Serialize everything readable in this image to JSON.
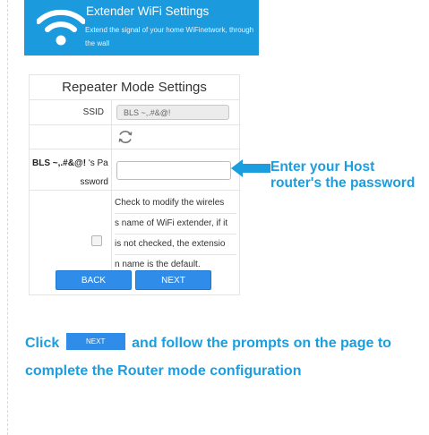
{
  "banner": {
    "title": "Extender WiFi Settings",
    "subtitle": "Extend the signal of your home WiFinetwork, through the wall"
  },
  "panel": {
    "title": "Repeater Mode Settings",
    "ssid_label": "SSID",
    "ssid_value": "BLS ~,.#&@!",
    "password_label_bold": "BLS ~,.#&@!",
    "password_label_suffix": " 's Pa",
    "password_label_line2": "ssword",
    "password_value": "",
    "check_text_lines": [
      "Check to modify the wireles",
      "s name of WiFi extender, if it",
      "is not checked, the extensio",
      "n name is the default."
    ],
    "checkbox_checked": false,
    "back_label": "BACK",
    "next_label": "NEXT"
  },
  "callout": {
    "text": "Enter your Host router's the password"
  },
  "instruction": {
    "click": "Click",
    "button_label": "NEXT",
    "rest": "and follow the prompts on the page to complete the Router mode configuration"
  },
  "icons": {
    "wifi": "wifi-icon",
    "refresh": "refresh-icon",
    "arrow": "arrow-left-icon"
  },
  "colors": {
    "accent": "#1b9ade",
    "button": "#2f8ce8",
    "hint_text": "#1a9ee0"
  }
}
